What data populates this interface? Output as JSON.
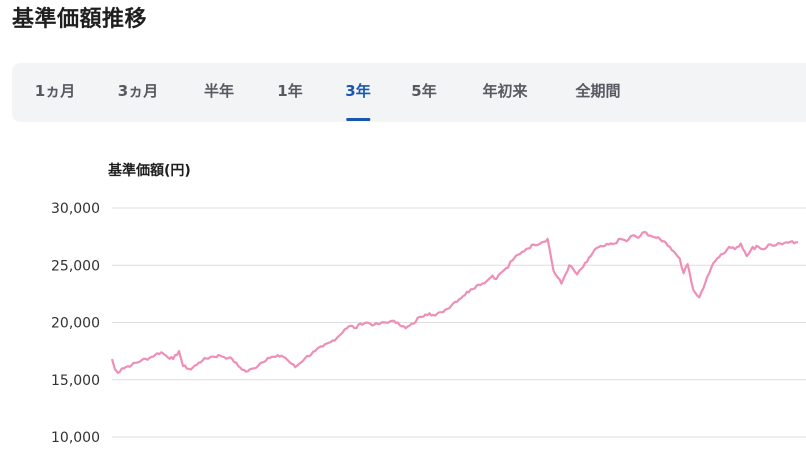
{
  "header": {
    "title": "基準価額推移"
  },
  "tabs": [
    {
      "label": "1ヵ月",
      "active": false
    },
    {
      "label": "3ヵ月",
      "active": false
    },
    {
      "label": "半年",
      "active": false
    },
    {
      "label": "1年",
      "active": false
    },
    {
      "label": "3年",
      "active": true
    },
    {
      "label": "5年",
      "active": false
    },
    {
      "label": "年初来",
      "active": false
    },
    {
      "label": "全期間",
      "active": false
    }
  ],
  "colors": {
    "accent": "#1a56b0",
    "line": "#ee8fb8",
    "grid": "#dddddd",
    "tabbar_bg": "#f3f4f6"
  },
  "chart_data": {
    "type": "line",
    "title": "",
    "xlabel": "",
    "ylabel": "基準価額(円)",
    "ylim": [
      10000,
      30000
    ],
    "yticks": [
      30000,
      25000,
      20000,
      15000,
      10000
    ],
    "ytick_labels": [
      "30,000",
      "25,000",
      "20,000",
      "15,000",
      "10,000"
    ],
    "grid": true,
    "series": [
      {
        "x": [
          0,
          3,
          6,
          10,
          20,
          30,
          38,
          44,
          50,
          55,
          62,
          68,
          72,
          80,
          88,
          92,
          100,
          110,
          118,
          122,
          128,
          136,
          144,
          150,
          158,
          166,
          172,
          176,
          182,
          186,
          196,
          206,
          214,
          222,
          230,
          236,
          242,
          248,
          252,
          258,
          266,
          272,
          282,
          290,
          298,
          306,
          312,
          318,
          322,
          328,
          334,
          340,
          348,
          356,
          364,
          372,
          380,
          386,
          390,
          394,
          398,
          402,
          404,
          408,
          414,
          420,
          428,
          436,
          442,
          448,
          456,
          464,
          472,
          482,
          490,
          500,
          510,
          516,
          522,
          528,
          534,
          540,
          546,
          552,
          560,
          566,
          572,
          576,
          580,
          584,
          590,
          596,
          602,
          608,
          614,
          620,
          626,
          632,
          638,
          644,
          650,
          652,
          654,
          660,
          666,
          672,
          678,
          684,
          690,
          694,
          696
        ],
        "values": [
          16800,
          15900,
          15600,
          16000,
          16300,
          16700,
          16900,
          17200,
          17400,
          17100,
          16800,
          17500,
          16200,
          15900,
          16500,
          16700,
          17000,
          17100,
          16900,
          16800,
          16200,
          15700,
          16000,
          16400,
          16900,
          17000,
          17100,
          16900,
          16400,
          16100,
          16900,
          17500,
          17900,
          18300,
          18800,
          19400,
          19700,
          19500,
          19900,
          20000,
          19800,
          19900,
          20100,
          20000,
          19500,
          19900,
          20500,
          20700,
          20800,
          20600,
          20900,
          21200,
          21800,
          22300,
          22900,
          23300,
          23600,
          24100,
          23800,
          24300,
          24600,
          24800,
          25300,
          25600,
          26000,
          26400,
          26800,
          27000,
          27300,
          24500,
          23400,
          25000,
          24200,
          25300,
          26400,
          26700,
          26900,
          27300,
          27100,
          27600,
          27400,
          27900,
          27600,
          27400,
          27100,
          26600,
          26000,
          25600,
          24300,
          25100,
          22800,
          22200,
          23500,
          24800,
          25600,
          26000,
          26600,
          26400,
          26900,
          25800,
          26600,
          26400,
          26700,
          26400,
          26800,
          26700,
          26900,
          27000,
          27100,
          27000,
          27000
        ]
      }
    ]
  }
}
